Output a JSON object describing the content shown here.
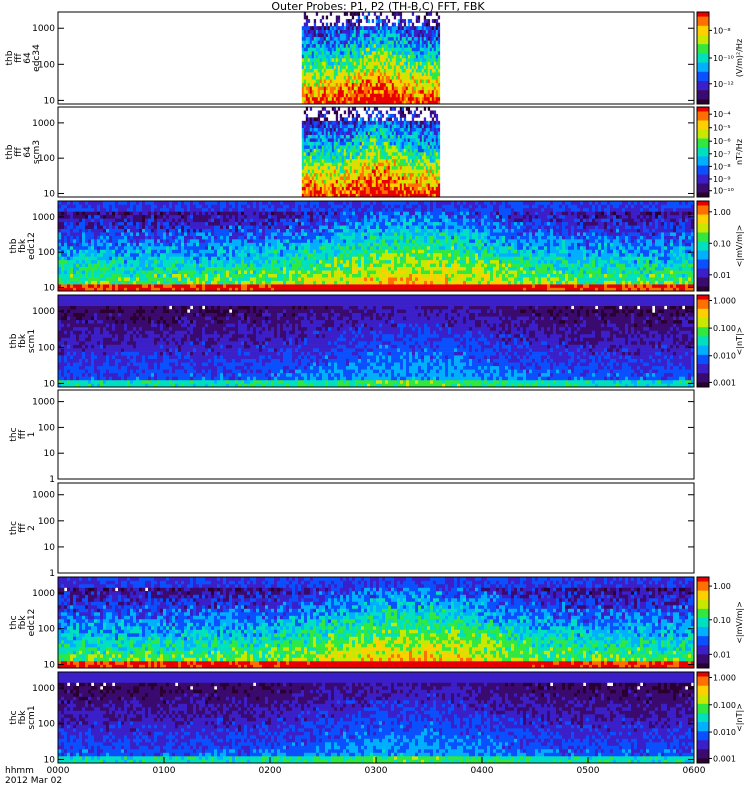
{
  "title": "Outer Probes: P1, P2 (TH-B,C) FFT, FBK",
  "x_axis": {
    "label_line1": "hhmm",
    "label_line2": "2012 Mar 02",
    "ticks": [
      "0000",
      "0100",
      "0200",
      "0300",
      "0400",
      "0500",
      "0600"
    ],
    "range_hours": [
      0,
      6
    ]
  },
  "colors": {
    "background": "#ffffff",
    "axes": "#000000",
    "colormap": [
      "#2a0030",
      "#3a0a6e",
      "#3b1fc8",
      "#0a50ff",
      "#00b0ff",
      "#00e0c0",
      "#30e840",
      "#c8e800",
      "#ffd000",
      "#ff7000",
      "#e80000"
    ]
  },
  "chart_data": [
    {
      "type": "heatmap",
      "panel_id": "thb-fff-64-edc34",
      "ylabel": [
        "thb",
        "fff",
        "64",
        "edc34"
      ],
      "y_ticks": [
        "10",
        "100",
        "1000"
      ],
      "y_scale": "log",
      "data_x_range_hours": [
        2.3,
        3.6
      ],
      "colorbar": {
        "unit": "(V/m)²/Hz",
        "ticks": [
          "10⁻⁸",
          "10⁻¹⁰",
          "10⁻¹²"
        ],
        "tick_pos": [
          0.2,
          0.5,
          0.78
        ]
      }
    },
    {
      "type": "heatmap",
      "panel_id": "thb-fff-64-scm3",
      "ylabel": [
        "thb",
        "fff",
        "64",
        "scm3"
      ],
      "y_ticks": [
        "10",
        "100",
        "1000"
      ],
      "y_scale": "log",
      "data_x_range_hours": [
        2.3,
        3.6
      ],
      "colorbar": {
        "unit": "nT²/Hz",
        "ticks": [
          "10⁻⁴",
          "10⁻⁵",
          "10⁻⁶",
          "10⁻⁷",
          "10⁻⁸",
          "10⁻⁹",
          "10⁻¹⁰"
        ],
        "tick_pos": [
          0.08,
          0.23,
          0.38,
          0.52,
          0.66,
          0.8,
          0.93
        ]
      }
    },
    {
      "type": "heatmap",
      "panel_id": "thb-fbk-edc12",
      "ylabel": [
        "thb",
        "fbk",
        "edc12"
      ],
      "y_ticks": [
        "10",
        "100",
        "1000"
      ],
      "y_scale": "log",
      "data_x_range_hours": [
        0,
        6
      ],
      "colorbar": {
        "unit": "<|mV/m|>",
        "ticks": [
          "1.00",
          "0.10",
          "0.01"
        ],
        "tick_pos": [
          0.12,
          0.47,
          0.82
        ]
      }
    },
    {
      "type": "heatmap",
      "panel_id": "thb-fbk-scm1",
      "ylabel": [
        "thb",
        "fbk",
        "scm1"
      ],
      "y_ticks": [
        "10",
        "100",
        "1000"
      ],
      "y_scale": "log",
      "data_x_range_hours": [
        0,
        6
      ],
      "colorbar": {
        "unit": "<|nT|>",
        "ticks": [
          "1.000",
          "0.100",
          "0.010",
          "0.001"
        ],
        "tick_pos": [
          0.06,
          0.36,
          0.66,
          0.95
        ]
      }
    },
    {
      "type": "heatmap",
      "panel_id": "thc-fff-1",
      "ylabel": [
        "thc",
        "fff",
        "1"
      ],
      "y_ticks": [
        "1",
        "10",
        "100",
        "1000"
      ],
      "y_scale": "log",
      "data_x_range_hours": null,
      "colorbar": null
    },
    {
      "type": "heatmap",
      "panel_id": "thc-fff-2",
      "ylabel": [
        "thc",
        "fff",
        "2"
      ],
      "y_ticks": [
        "1",
        "10",
        "100",
        "1000"
      ],
      "y_scale": "log",
      "data_x_range_hours": null,
      "colorbar": null
    },
    {
      "type": "heatmap",
      "panel_id": "thc-fbk-edc12",
      "ylabel": [
        "thc",
        "fbk",
        "edc12"
      ],
      "y_ticks": [
        "10",
        "100",
        "1000"
      ],
      "y_scale": "log",
      "data_x_range_hours": [
        0,
        6
      ],
      "colorbar": {
        "unit": "<|mV/m|>",
        "ticks": [
          "1.00",
          "0.10",
          "0.01"
        ],
        "tick_pos": [
          0.1,
          0.47,
          0.85
        ]
      }
    },
    {
      "type": "heatmap",
      "panel_id": "thc-fbk-scm1",
      "ylabel": [
        "thc",
        "fbk",
        "scm1"
      ],
      "y_ticks": [
        "10",
        "100",
        "1000"
      ],
      "y_scale": "log",
      "data_x_range_hours": [
        0,
        6
      ],
      "colorbar": {
        "unit": "<|nT|>",
        "ticks": [
          "1.000",
          "0.100",
          "0.010",
          "0.001"
        ],
        "tick_pos": [
          0.06,
          0.36,
          0.66,
          0.95
        ]
      }
    }
  ]
}
